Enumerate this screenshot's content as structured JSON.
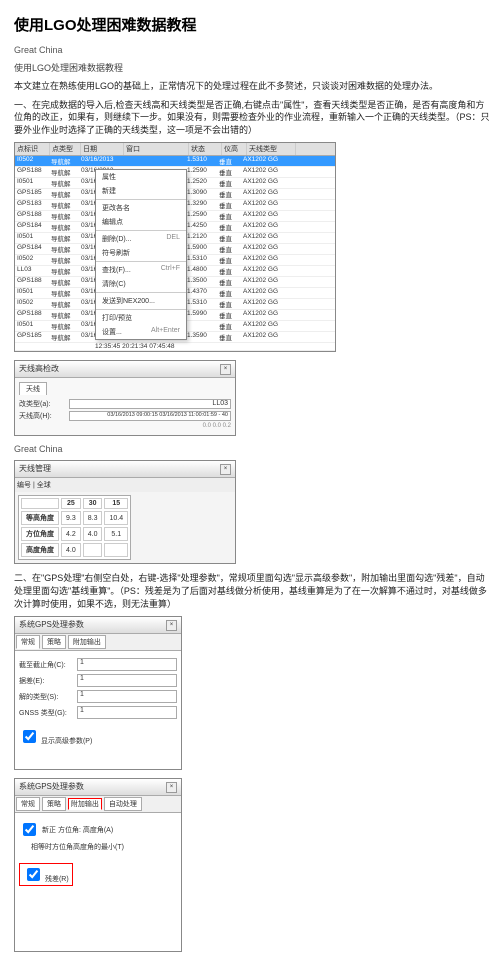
{
  "title": "使用LGO处理困难数据教程",
  "author": "Great China",
  "subtitle": "使用LGO处理困难数据教程",
  "para1": "本文建立在熟练使用LGO的基础上，正常情况下的处理过程在此不多赘述，只谈谈对困难数据的处理办法。",
  "para2": "一、在完成数据的导入后,检查天线高和天线类型是否正确,右键点击\"属性\"，查看天线类型是否正确，是否有高度角和方位角的改正，如果有，则继续下一步。如果没有，则需要检查外业的作业流程，重新输入一个正确的天线类型。（PS：只要外业作业时选择了正确的天线类型，这一项是不会出错的）",
  "table1": {
    "headers": [
      "点标识",
      "点类型",
      "日期",
      "窗口",
      "状态",
      "仪高",
      "天线类型"
    ],
    "rows": [
      [
        "I0502",
        "导航解",
        "03/16/2013",
        "",
        "1.5310",
        "垂直",
        "AX1202 GG"
      ],
      [
        "GPS188",
        "导航解",
        "03/16/2013",
        "",
        "1.2590",
        "垂直",
        "AX1202 GG"
      ],
      [
        "I0501",
        "导航解",
        "03/16/2013",
        "",
        "1.2520",
        "垂直",
        "AX1202 GG"
      ],
      [
        "GPS185",
        "导航解",
        "03/16/2013",
        "",
        "1.3090",
        "垂直",
        "AX1202 GG"
      ],
      [
        "GPS183",
        "导航解",
        "03/16/2013",
        "",
        "1.3290",
        "垂直",
        "AX1202 GG"
      ],
      [
        "GPS188",
        "导航解",
        "03/16/2013",
        "",
        "1.2590",
        "垂直",
        "AX1202 GG"
      ],
      [
        "GPS184",
        "导航解",
        "03/16/2013",
        "",
        "1.4250",
        "垂直",
        "AX1202 GG"
      ],
      [
        "I0501",
        "导航解",
        "03/16/2013",
        "",
        "1.2120",
        "垂直",
        "AX1202 GG"
      ],
      [
        "GPS184",
        "导航解",
        "03/16/2013",
        "",
        "1.5900",
        "垂直",
        "AX1202 GG"
      ],
      [
        "I0502",
        "导航解",
        "03/16/2013",
        "",
        "1.5310",
        "垂直",
        "AX1202 GG"
      ],
      [
        "LL03",
        "导航解",
        "03/16/2013",
        "",
        "1.4800",
        "垂直",
        "AX1202 GG"
      ],
      [
        "GPS188",
        "导航解",
        "03/16/2013",
        "",
        "1.3500",
        "垂直",
        "AX1202 GG"
      ],
      [
        "I0501",
        "导航解",
        "03/16/2013",
        "",
        "1.4370",
        "垂直",
        "AX1202 GG"
      ],
      [
        "I0502",
        "导航解",
        "03/16/2013",
        "",
        "1.5310",
        "垂直",
        "AX1202 GG"
      ],
      [
        "GPS188",
        "导航解",
        "03/16/2013",
        "",
        "1.5990",
        "垂直",
        "AX1202 GG"
      ],
      [
        "I0501",
        "导航解",
        "03/16/2013",
        "",
        "",
        "垂直",
        "AX1202 GG"
      ],
      [
        "GPS185",
        "导航解",
        "03/16/2013",
        "",
        "1.3590",
        "垂直",
        "AX1202 GG"
      ]
    ],
    "footer_time": "12:35:45 20:21:34 07:45:48"
  },
  "ctxmenu": {
    "items": [
      {
        "label": "属性",
        "shortcut": ""
      },
      {
        "label": "新建",
        "shortcut": ""
      },
      {
        "label": "更改各名",
        "shortcut": ""
      },
      {
        "label": "编辑点",
        "shortcut": ""
      },
      {
        "label": "删除(D)...",
        "shortcut": "DEL"
      },
      {
        "label": "符号刷新",
        "shortcut": ""
      },
      {
        "label": "查找(F)...",
        "shortcut": "Ctrl+F"
      },
      {
        "label": "清除(C)",
        "shortcut": ""
      },
      {
        "label": "发送到NEX200...",
        "shortcut": ""
      },
      {
        "label": "打印/预览",
        "shortcut": ""
      },
      {
        "label": "设置...",
        "shortcut": "Alt+Enter"
      }
    ]
  },
  "dialog2": {
    "title": "天线高检改",
    "tab": "天线",
    "rows": [
      {
        "label": "改类型(a):",
        "value": "LL03"
      },
      {
        "label": "天线高(H):",
        "value": "03/16/2013 09:00:15 03/16/2013 11:00:01:59 - 40"
      }
    ],
    "footer": "0.0 0.0 0.2"
  },
  "author2": "Great China",
  "dialog3": {
    "title": "天线管理",
    "tabs": "编号 | 全球",
    "headers": [
      "",
      "25",
      "30",
      "15"
    ],
    "rows": [
      [
        "等高角度",
        "9.3",
        "8.3",
        "10.4"
      ],
      [
        "方位角度",
        "4.2",
        "4.0",
        "5.1"
      ],
      [
        "高度角度",
        "4.0",
        "",
        ""
      ]
    ]
  },
  "para3": "二、在\"GPS处理\"右侧空白处，右键-选择\"处理参数\"，常规项里面勾选\"显示高级参数\"，附加输出里面勾选\"残差\"，自动处理里面勾选\"基线重算\"。（PS：残差是为了后面对基线做分析使用，基线重算是为了在一次解算不通过时，对基线做多次计算时使用，如果不选，则无法重算）",
  "panel4": {
    "title": "系统GPS处理参数",
    "tabs": [
      "常规",
      "策略",
      "附加输出"
    ],
    "rows": [
      {
        "label": "截至截止角(C):",
        "value": "1"
      },
      {
        "label": "据差(E):",
        "value": "1"
      },
      {
        "label": "解的类型(S):",
        "value": "1"
      },
      {
        "label": "GNSS 类型(G):",
        "value": "1"
      }
    ],
    "checkbox": "显示高级参数(P)"
  },
  "panel5": {
    "title": "系统GPS处理参数",
    "tabs": [
      "常规",
      "策略",
      "附加输出",
      "自动处理"
    ],
    "checks": [
      "新正 方位角: 高度角(A)",
      "相等时方位角高度角的最小(T)"
    ],
    "redcheck": "残差(R)"
  }
}
